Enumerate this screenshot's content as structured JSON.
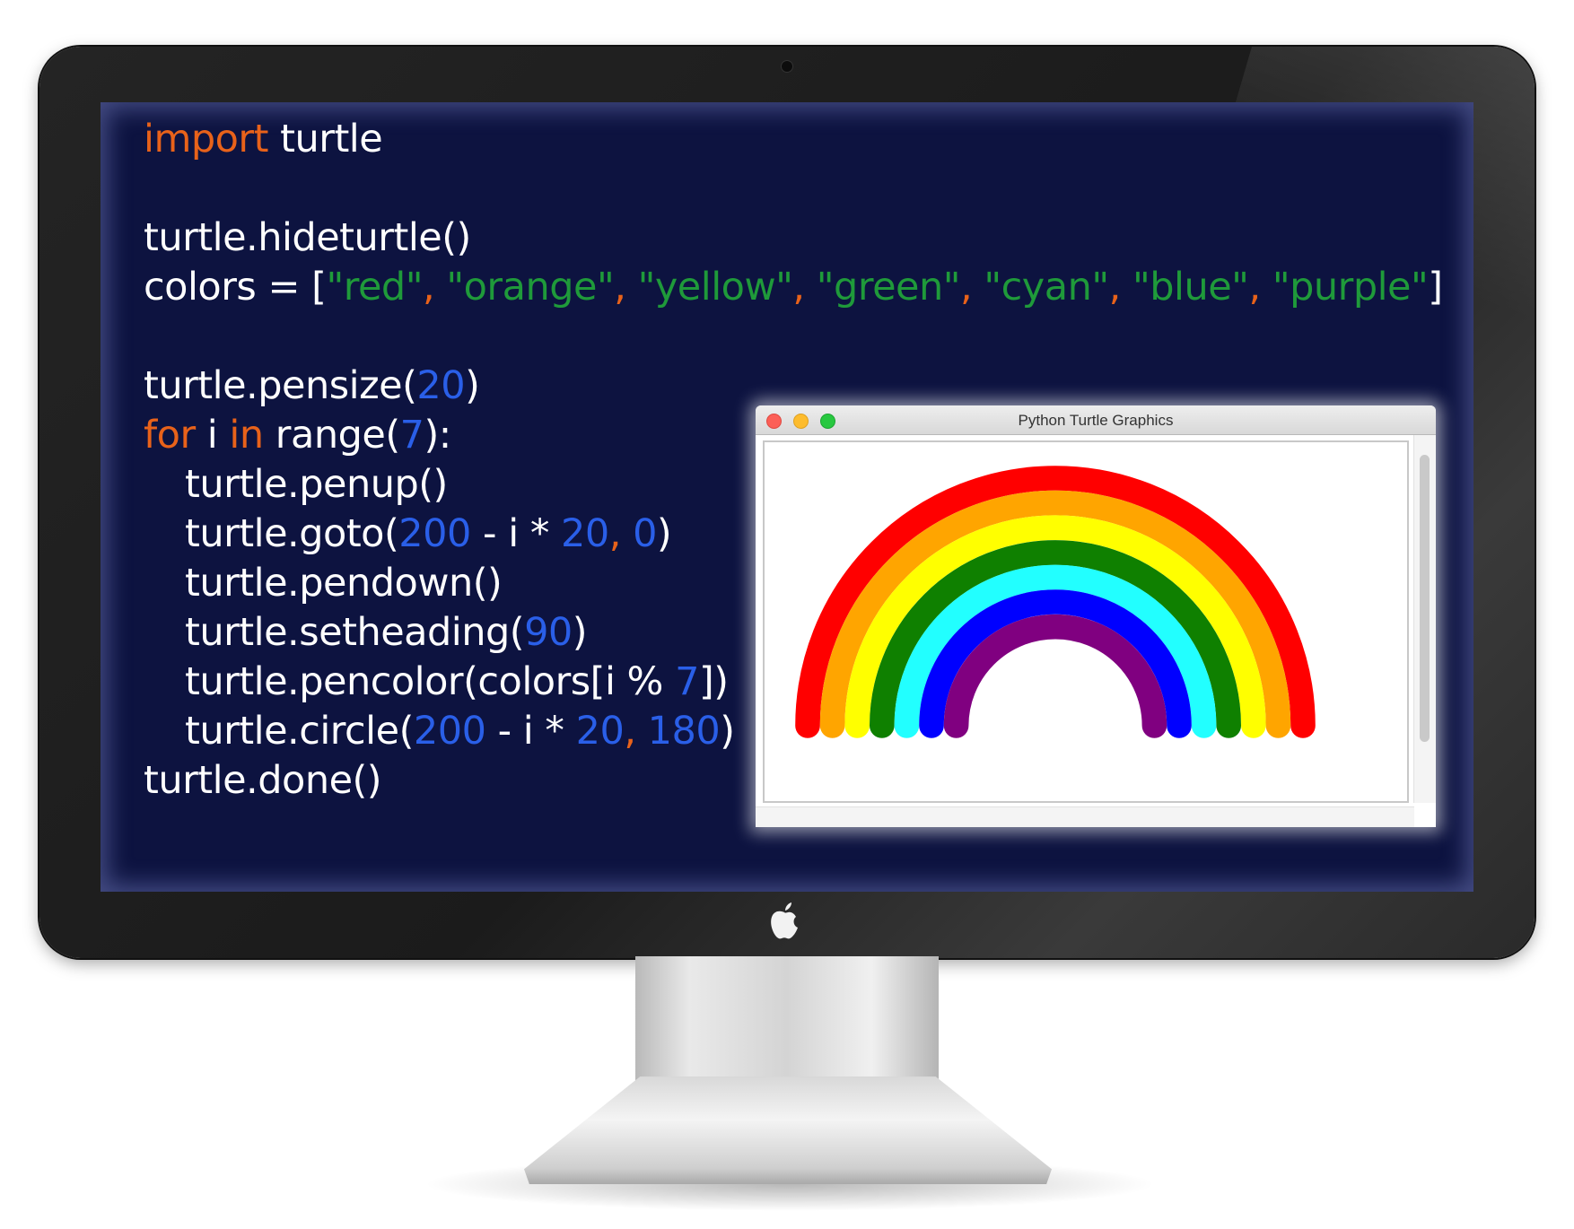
{
  "window": {
    "title": "Python Turtle Graphics",
    "traffic_lights": [
      "close",
      "minimize",
      "zoom"
    ]
  },
  "code": {
    "line1": {
      "kw": "import",
      "rest": " turtle"
    },
    "line3": "turtle.hideturtle()",
    "line4": {
      "prefix": "colors = [",
      "items": [
        "\"red\"",
        "\"orange\"",
        "\"yellow\"",
        "\"green\"",
        "\"cyan\"",
        "\"blue\"",
        "\"purple\""
      ],
      "sep": ", ",
      "suffix": "]"
    },
    "line6": {
      "a": "turtle.pensize(",
      "n": "20",
      "b": ")"
    },
    "line7": {
      "kw1": "for",
      "mid": " i ",
      "kw2": "in",
      "c": " range(",
      "n": "7",
      "d": "):"
    },
    "line8": "turtle.penup()",
    "line9": {
      "a": "turtle.goto(",
      "n1": "200",
      "b": " - i * ",
      "n2": "20",
      "sep": ", ",
      "n3": "0",
      "c": ")"
    },
    "line10": "turtle.pendown()",
    "line11": {
      "a": "turtle.setheading(",
      "n": "90",
      "b": ")"
    },
    "line12": {
      "a": "turtle.pencolor(colors[i % ",
      "n": "7",
      "b": "])"
    },
    "line13": {
      "a": "turtle.circle(",
      "n1": "200",
      "b": " - i * ",
      "n2": "20",
      "sep": ", ",
      "n3": "180",
      "c": ")"
    },
    "line14": "turtle.done()"
  },
  "rainbow": {
    "colors": [
      "#ff0000",
      "#ffa500",
      "#ffff00",
      "#0f8000",
      "#22ffff",
      "#0000ff",
      "#800080"
    ],
    "pensize": 20
  },
  "colors": {
    "screen_bg": "#0d1340",
    "keyword": "#e8621a",
    "string": "#1f9a3a",
    "number": "#2a5fe8",
    "text": "#ffffff"
  }
}
